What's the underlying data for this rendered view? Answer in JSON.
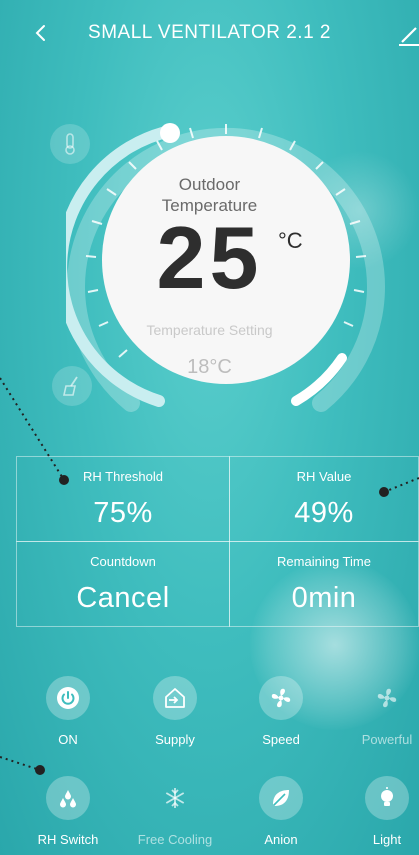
{
  "header": {
    "title": "SMALL VENTILATOR 2.1 2"
  },
  "dial": {
    "outdoor_label_line1": "Outdoor",
    "outdoor_label_line2": "Temperature",
    "temperature": "25",
    "unit": "°C",
    "setting_label": "Temperature Setting",
    "setting_value": "18°C"
  },
  "info": {
    "rh_threshold_label": "RH Threshold",
    "rh_threshold_value": "75%",
    "rh_value_label": "RH Value",
    "rh_value_value": "49%",
    "countdown_label": "Countdown",
    "countdown_value": "Cancel",
    "remaining_label": "Remaining Time",
    "remaining_value": "0min"
  },
  "controls_row1": [
    {
      "label": "ON",
      "icon": "power-icon"
    },
    {
      "label": "Supply",
      "icon": "supply-icon"
    },
    {
      "label": "Speed",
      "icon": "fan-speed-icon"
    },
    {
      "label": "Powerful",
      "icon": "fan-powerful-icon"
    }
  ],
  "controls_row2": [
    {
      "label": "RH Switch",
      "icon": "drops-icon"
    },
    {
      "label": "Free Cooling",
      "icon": "snowflake-icon"
    },
    {
      "label": "Anion",
      "icon": "leaf-icon"
    },
    {
      "label": "Light",
      "icon": "bulb-icon"
    }
  ],
  "colors": {
    "background": "#3fbdbe",
    "dial_arc": "#c9eef0",
    "text": "#ffffff",
    "temperature_text": "#2e2e2e"
  }
}
